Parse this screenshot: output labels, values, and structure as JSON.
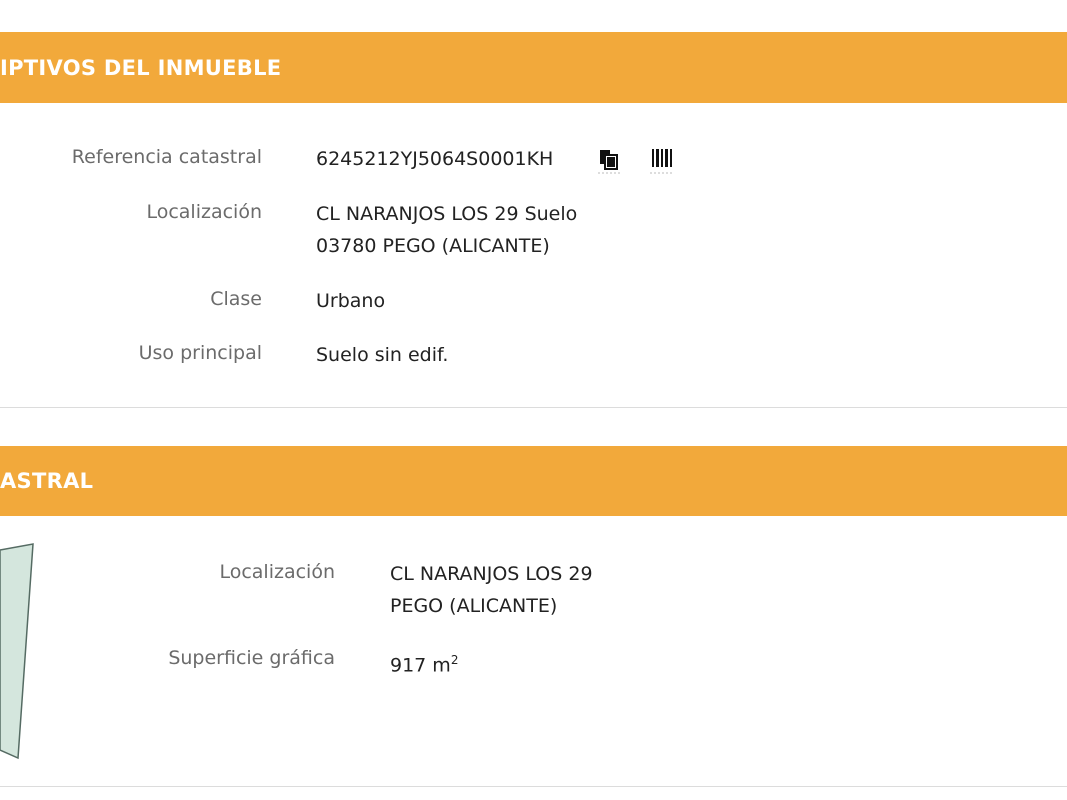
{
  "section1": {
    "title": "IPTIVOS DEL INMUEBLE",
    "fields": {
      "referencia_label": "Referencia catastral",
      "referencia_value": "6245212YJ5064S0001KH",
      "localizacion_label": "Localización",
      "localizacion_line1": "CL NARANJOS LOS 29 Suelo",
      "localizacion_line2": "03780 PEGO (ALICANTE)",
      "clase_label": "Clase",
      "clase_value": "Urbano",
      "uso_label": "Uso principal",
      "uso_value": "Suelo sin edif."
    },
    "icons": [
      "copy-icon",
      "barcode-icon"
    ]
  },
  "section2": {
    "title": "ASTRAL",
    "fields": {
      "localizacion_label": "Localización",
      "localizacion_line1": "CL NARANJOS LOS 29",
      "localizacion_line2": "PEGO (ALICANTE)",
      "superficie_label": "Superficie gráfica",
      "superficie_value": "917 m",
      "superficie_unit_exp": "2"
    }
  },
  "colors": {
    "header_bg": "#f2a93b",
    "header_text": "#ffffff",
    "label_text": "#6b6b6b",
    "value_text": "#222222",
    "parcel_fill": "#d4e6dd"
  }
}
